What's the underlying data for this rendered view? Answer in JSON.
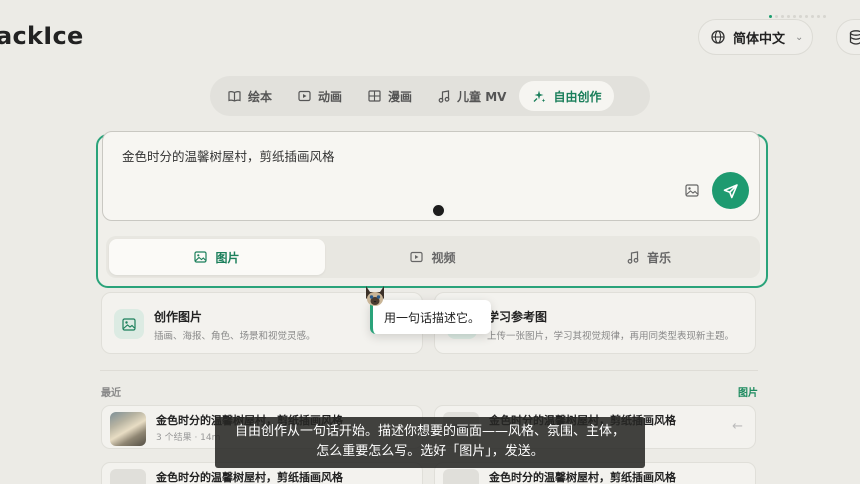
{
  "header": {
    "logo_text": "ackIce",
    "language_label": "简体中文",
    "language_chevron": "⌄",
    "icons": {
      "globe": "globe-icon",
      "database": "database-icon"
    },
    "progress": {
      "total_steps": 10,
      "current_step": 1
    }
  },
  "modes": [
    {
      "label": "绘本",
      "icon": "book-icon",
      "active": false
    },
    {
      "label": "动画",
      "icon": "play-icon",
      "active": false
    },
    {
      "label": "漫画",
      "icon": "grid-icon",
      "active": false
    },
    {
      "label": "儿童 MV",
      "icon": "music-icon",
      "active": false
    },
    {
      "label": "自由创作",
      "icon": "sparkle-icon",
      "active": true
    }
  ],
  "composer": {
    "prompt_value": "金色时分的温馨树屋村，剪纸插画风格",
    "output_tabs": [
      {
        "label": "图片",
        "icon": "image-icon",
        "active": true
      },
      {
        "label": "视频",
        "icon": "video-icon",
        "active": false
      },
      {
        "label": "音乐",
        "icon": "music-icon",
        "active": false
      }
    ]
  },
  "cards": [
    {
      "title": "创作图片",
      "desc": "插画、海报、角色、场景和视觉灵感。",
      "icon": "image-icon"
    },
    {
      "title": "学习参考图",
      "desc": "上传一张图片，学习其视觉规律，再用同类型表现新主题。",
      "icon": "upload-icon"
    }
  ],
  "recent": {
    "label": "最近",
    "filter_label": "图片",
    "items": [
      {
        "title": "金色时分的温馨树屋村，剪纸插画风格",
        "meta": "3 个结果 · 14m",
        "thumb": "photo"
      },
      {
        "title": "金色时分的温馨树屋村，剪纸插画风格",
        "meta": "",
        "thumb": "plain"
      },
      {
        "title": "金色时分的温馨树屋村，剪纸插画风格",
        "meta": "",
        "thumb": "plain"
      },
      {
        "title": "金色时分的温馨树屋村，剪纸插画风格",
        "meta": "",
        "thumb": "plain"
      }
    ]
  },
  "tooltip": {
    "text": "用一句话描述它。"
  },
  "caption": {
    "line1": "自由创作从一句话开始。描述你想要的画面——风格、氛围、主体，",
    "line2": "怎么重要怎么写。选好「图片」，发送。"
  },
  "colors": {
    "accent": "#1e9a70",
    "background": "#ecebe6",
    "caption_bg": "#262624"
  }
}
